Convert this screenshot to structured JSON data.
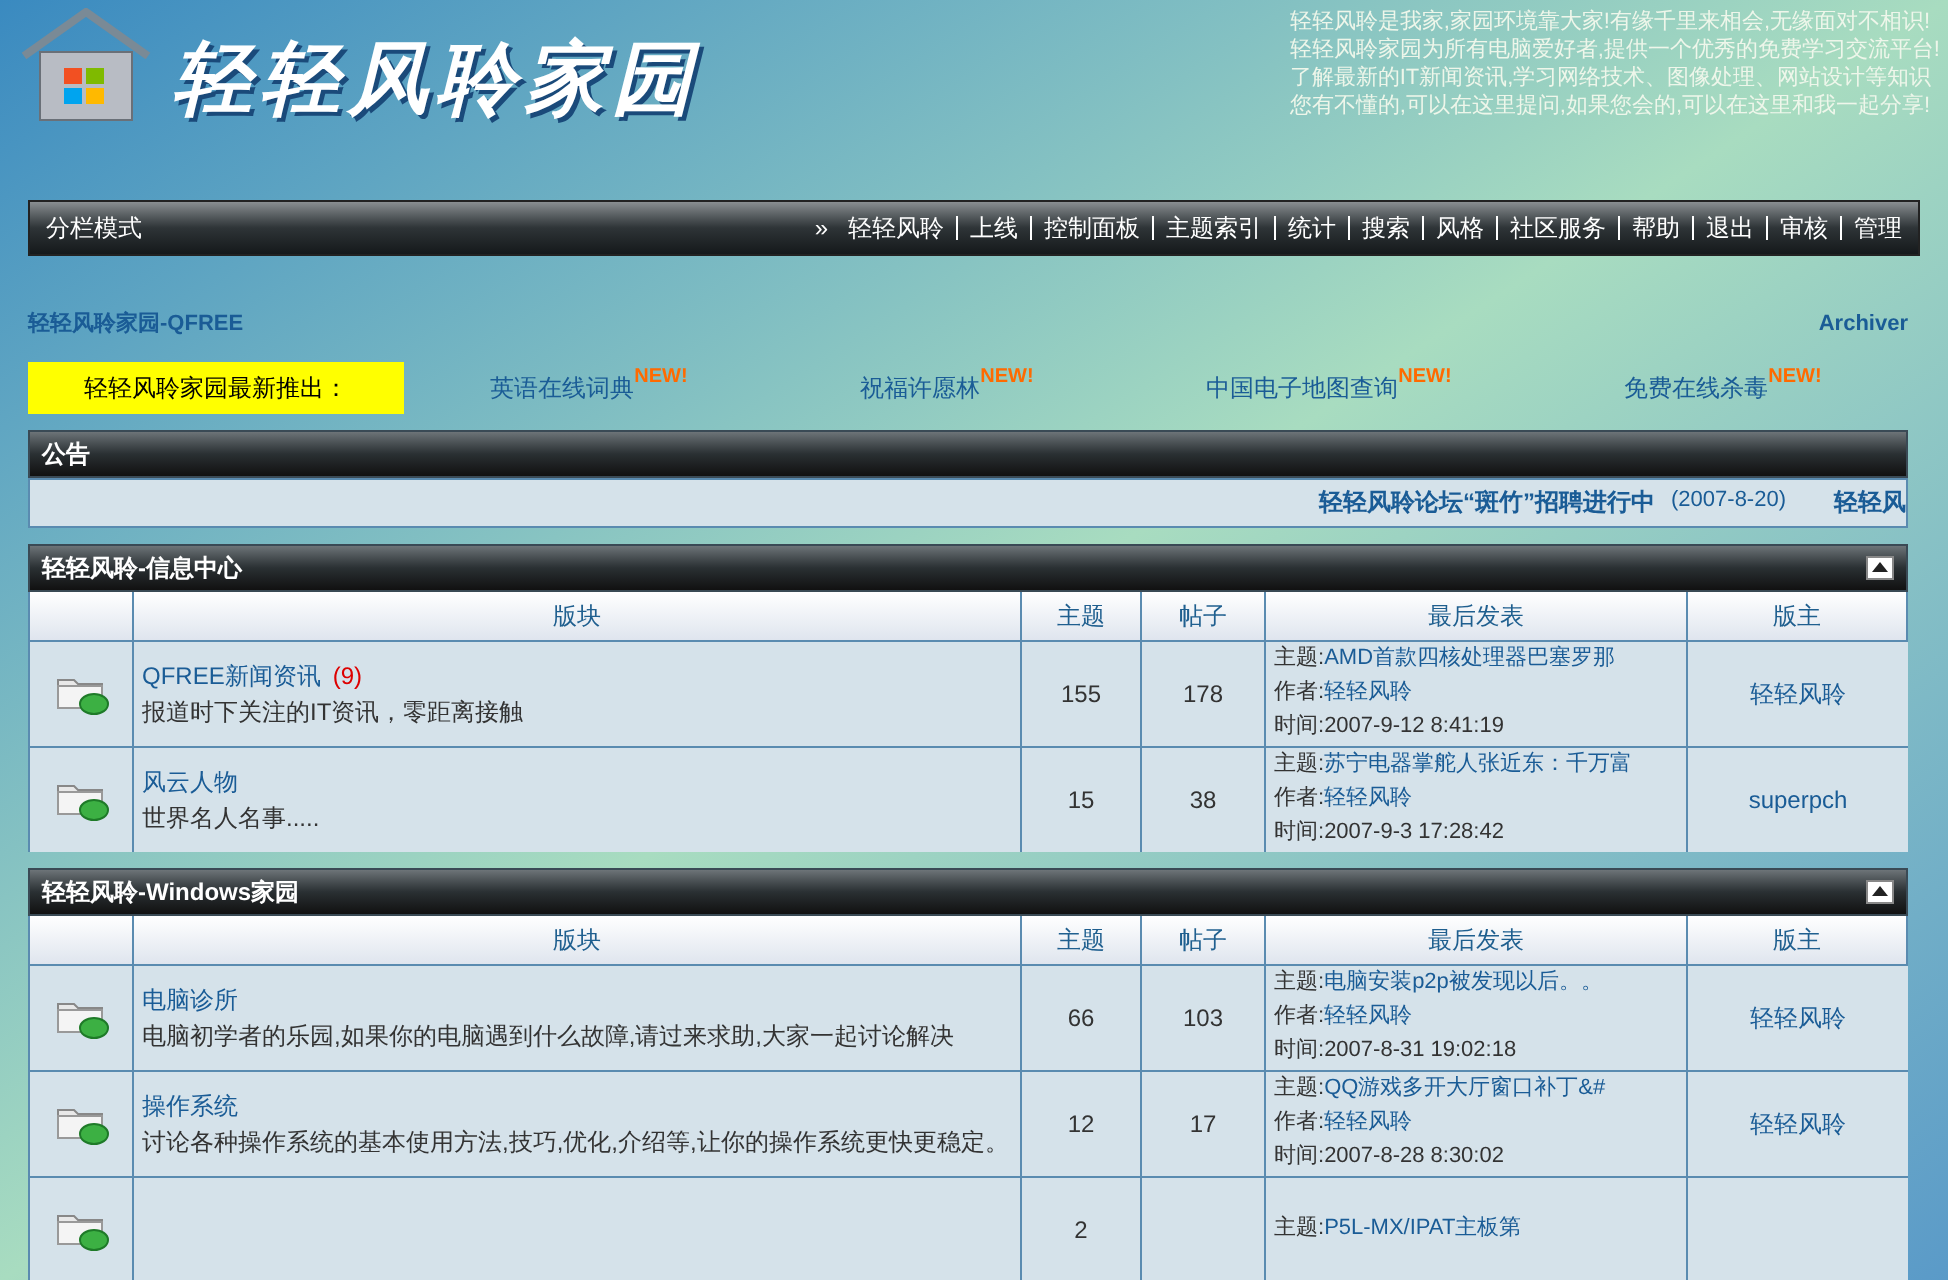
{
  "header": {
    "logo_text": "轻轻风聆家园",
    "intro_lines": [
      "轻轻风聆是我家,家园环境靠大家!有缘千里来相会,无缘面对不相识!",
      "轻轻风聆家园为所有电脑爱好者,提供一个优秀的免费学习交流平台!",
      "了解最新的IT新闻资讯,学习网络技术、图像处理、网站设计等知识",
      "您有不懂的,可以在这里提问,如果您会的,可以在这里和我一起分享!"
    ]
  },
  "nav": {
    "mode": "分栏模式",
    "arrow": "»",
    "items": [
      "轻轻风聆",
      "上线",
      "控制面板",
      "主题索引",
      "统计",
      "搜索",
      "风格",
      "社区服务",
      "帮助",
      "退出",
      "审核",
      "管理"
    ]
  },
  "breadcrumb": {
    "title": "轻轻风聆家园-QFREE",
    "archiver": "Archiver"
  },
  "promo": {
    "label": "轻轻风聆家园最新推出：",
    "links": [
      {
        "text": "英语在线词典",
        "badge": "NEW!"
      },
      {
        "text": "祝福许愿林",
        "badge": "NEW!"
      },
      {
        "text": "中国电子地图查询",
        "badge": "NEW!"
      },
      {
        "text": "免费在线杀毒",
        "badge": "NEW!"
      }
    ]
  },
  "announcement": {
    "title": "公告",
    "items": [
      {
        "text": "轻轻风聆论坛“斑竹”招聘进行中",
        "date": "(2007-8-20)"
      },
      {
        "text": "轻轻风"
      }
    ]
  },
  "sections": [
    {
      "title": "轻轻风聆-信息中心",
      "columns": [
        "版块",
        "主题",
        "帖子",
        "最后发表",
        "版主"
      ],
      "rows": [
        {
          "name": "QFREE新闻资讯",
          "new_count": "(9)",
          "description": "报道时下关注的IT资讯，零距离接触",
          "topics": "155",
          "posts": "178",
          "last_post": [
            {
              "label": "主题:",
              "value": "AMD首款四核处理器巴塞罗那"
            },
            {
              "label": "作者:",
              "value": "轻轻风聆"
            },
            {
              "label": "时间:",
              "value": "2007-9-12 8:41:19"
            }
          ],
          "moderator": "轻轻风聆"
        },
        {
          "name": "风云人物",
          "description": "世界名人名事.....",
          "topics": "15",
          "posts": "38",
          "last_post": [
            {
              "label": "主题:",
              "value": "苏宁电器掌舵人张近东：千万富"
            },
            {
              "label": "作者:",
              "value": "轻轻风聆"
            },
            {
              "label": "时间:",
              "value": "2007-9-3 17:28:42"
            }
          ],
          "moderator": "superpch"
        }
      ]
    },
    {
      "title": "轻轻风聆-Windows家园",
      "columns": [
        "版块",
        "主题",
        "帖子",
        "最后发表",
        "版主"
      ],
      "rows": [
        {
          "name": "电脑诊所",
          "description": "电脑初学者的乐园,如果你的电脑遇到什么故障,请过来求助,大家一起讨论解决",
          "topics": "66",
          "posts": "103",
          "last_post": [
            {
              "label": "主题:",
              "value": "电脑安装p2p被发现以后。。"
            },
            {
              "label": "作者:",
              "value": "轻轻风聆"
            },
            {
              "label": "时间:",
              "value": "2007-8-31 19:02:18"
            }
          ],
          "moderator": "轻轻风聆"
        },
        {
          "name": "操作系统",
          "description": "讨论各种操作系统的基本使用方法,技巧,优化,介绍等,让你的操作系统更快更稳定。",
          "topics": "12",
          "posts": "17",
          "last_post": [
            {
              "label": "主题:",
              "value": "QQ游戏多开大厅窗口补丁&#"
            },
            {
              "label": "作者:",
              "value": "轻轻风聆"
            },
            {
              "label": "时间:",
              "value": "2007-8-28 8:30:02"
            }
          ],
          "moderator": "轻轻风聆"
        },
        {
          "topics": "2",
          "last_post": [
            {
              "label": "主题:",
              "value": "P5L-MX/IPAT主板第"
            }
          ]
        }
      ]
    }
  ]
}
